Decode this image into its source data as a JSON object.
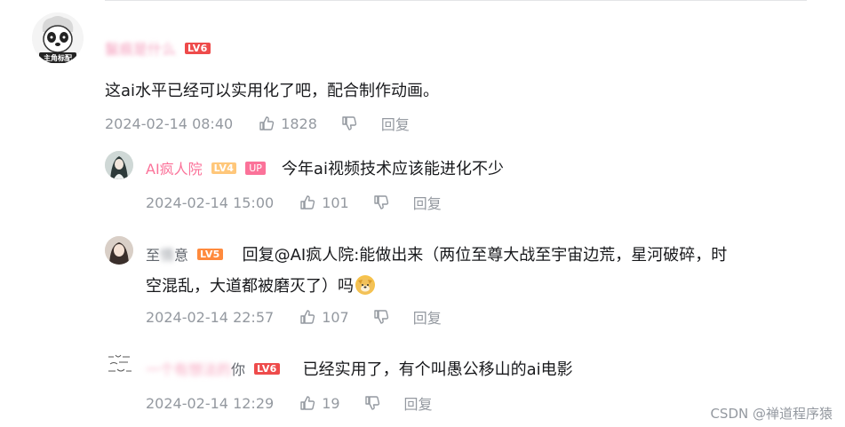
{
  "comments": [
    {
      "username": "鬣痕是什么",
      "level": "LV6",
      "avatar_label": "主角标配",
      "content": "这ai水平已经可以实用化了吧，配合制作动画。",
      "time": "2024-02-14 08:40",
      "likes": "1828",
      "reply_label": "回复"
    },
    {
      "username": "AI疯人院",
      "level": "LV4",
      "up_badge": "UP",
      "content": "今年ai视频技术应该能进化不少",
      "time": "2024-02-14 15:00",
      "likes": "101",
      "reply_label": "回复"
    },
    {
      "username_visible": "至",
      "username_hidden": "情",
      "username_end": "意",
      "level": "LV5",
      "reply_prefix": "回复 ",
      "reply_mention": "@AI疯人院",
      "content_line1": ":能做出来（两位至尊大战至宇宙边荒，星河破碎，时",
      "content_line2": "空混乱，大道都被磨灭了）吗",
      "time": "2024-02-14 22:57",
      "likes": "107",
      "reply_label": "回复"
    },
    {
      "username_hidden": "一个有想法的",
      "username_end": "你",
      "level": "LV6",
      "avatar_label": "个有想法的",
      "content": "已经实用了，有个叫愚公移山的ai电影",
      "time": "2024-02-14 12:29",
      "likes": "19",
      "reply_label": "回复"
    }
  ],
  "watermark": "CSDN @禅道程序猿"
}
